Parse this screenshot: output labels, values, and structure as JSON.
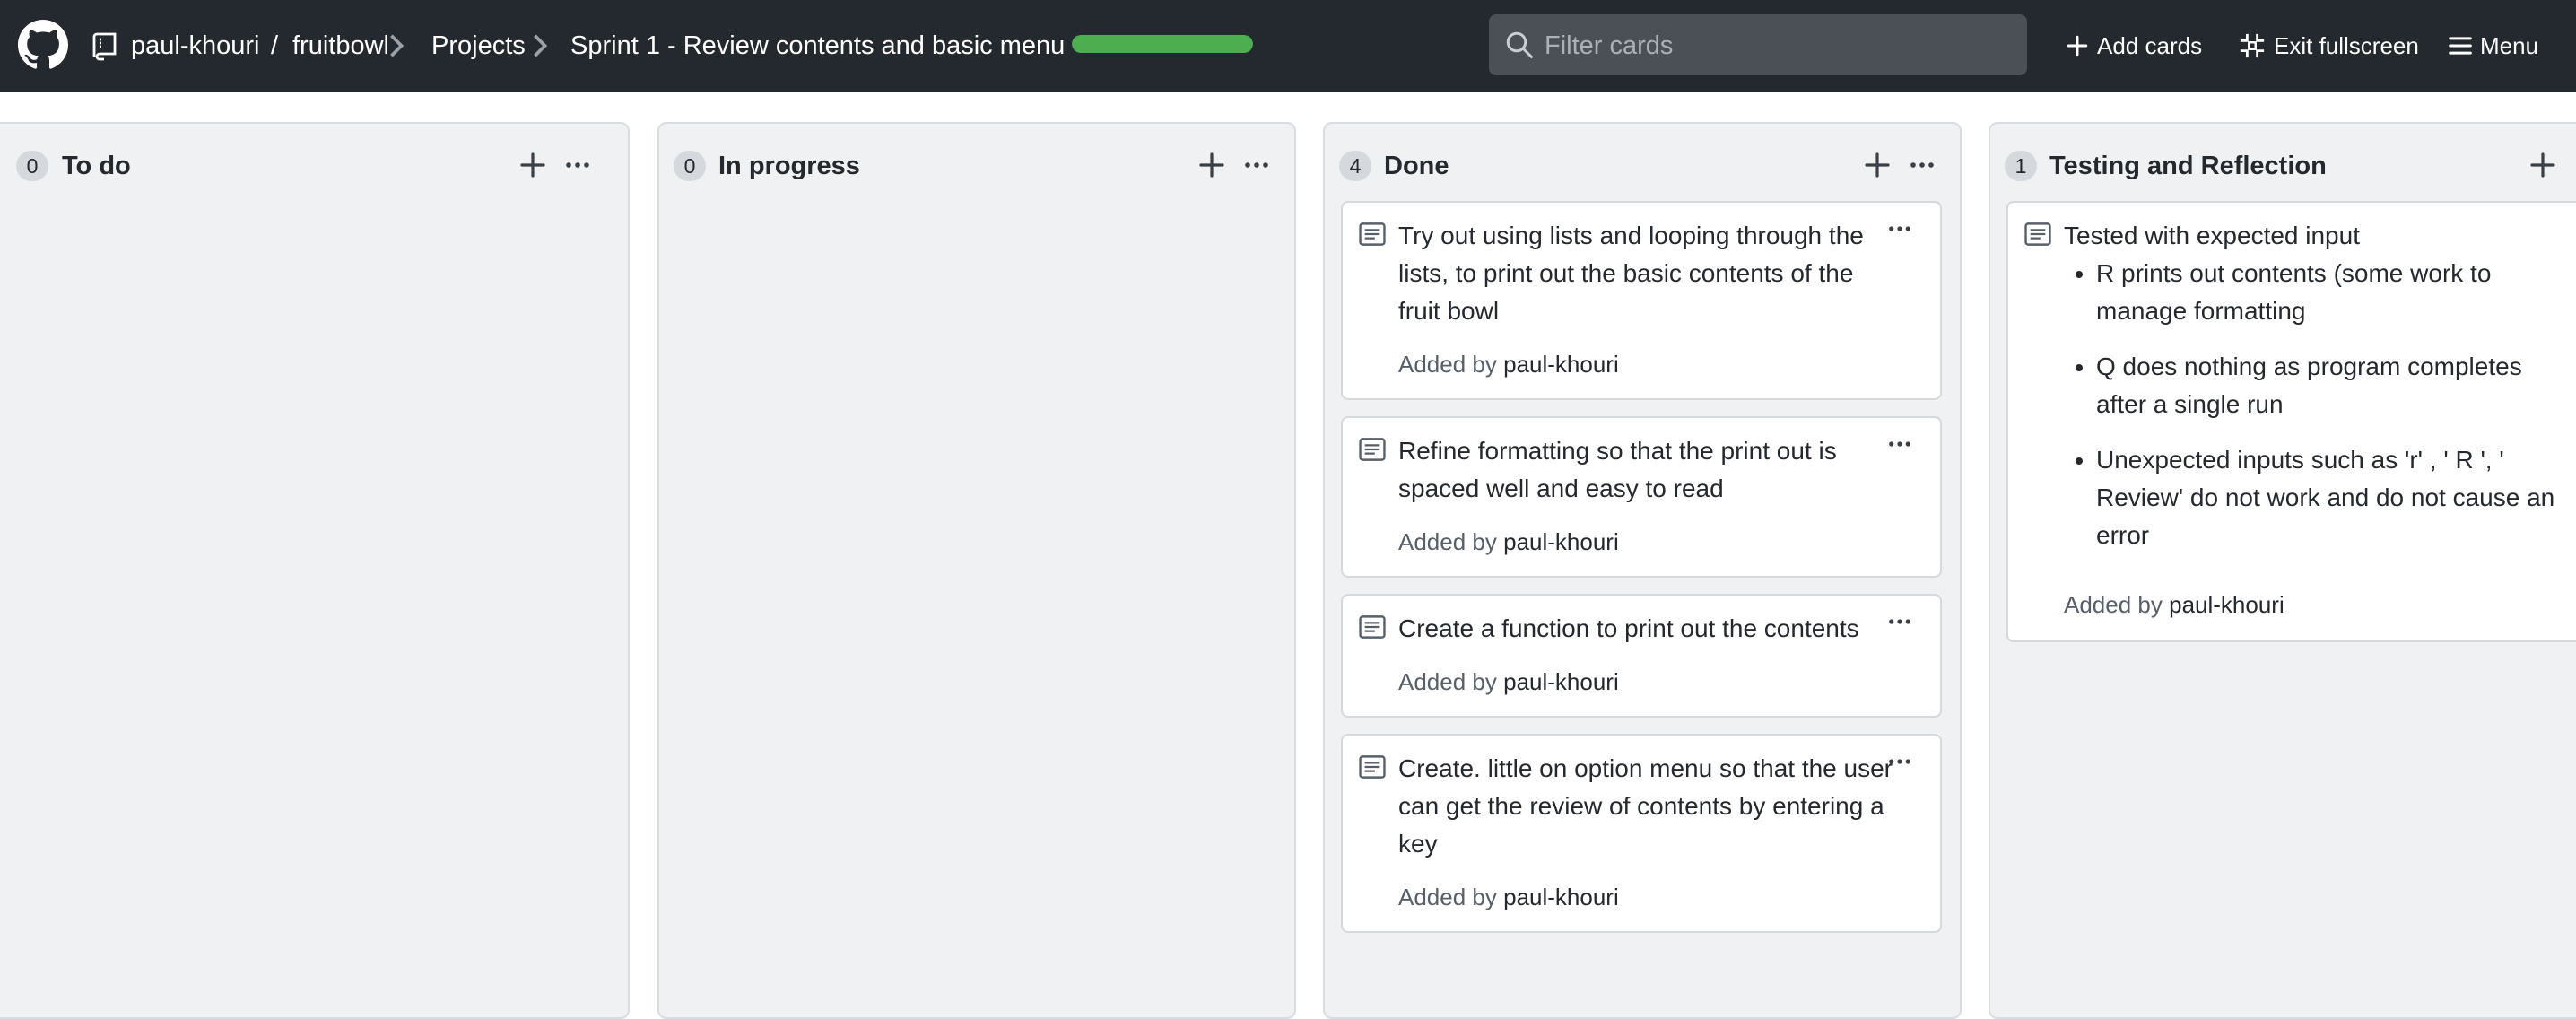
{
  "header": {
    "breadcrumb": {
      "owner": "paul-khouri",
      "separator": "/",
      "repo": "fruitbowl",
      "projects": "Projects",
      "project": "Sprint 1 - Review contents and basic menu"
    },
    "progress_fraction": 1.0,
    "progress_color": "#4cae4f",
    "filter_placeholder": "Filter cards",
    "add_cards": "Add cards",
    "exit_fullscreen": "Exit fullscreen",
    "menu": "Menu"
  },
  "columns": [
    {
      "count": "0",
      "title": "To do",
      "cards": []
    },
    {
      "count": "0",
      "title": "In progress",
      "cards": []
    },
    {
      "count": "4",
      "title": "Done",
      "cards": [
        {
          "text": "Try out using lists and looping through the lists, to print out the basic contents of the fruit bowl",
          "added_by_label": "Added by",
          "user": "paul-khouri"
        },
        {
          "text": "Refine formatting so that the print out is spaced well and easy to read",
          "added_by_label": "Added by",
          "user": "paul-khouri"
        },
        {
          "text": "Create a function to print out the contents",
          "added_by_label": "Added by",
          "user": "paul-khouri"
        },
        {
          "text": "Create. little on option menu so that the user can get the review of contents by entering a key",
          "added_by_label": "Added by",
          "user": "paul-khouri"
        }
      ]
    },
    {
      "count": "1",
      "title": "Testing and Reflection",
      "cards": [
        {
          "text": "Tested with expected input",
          "bullets": [
            "R prints out contents (some work to manage formatting",
            "Q does nothing as program completes after a single run",
            "Unexpected inputs such as 'r' , ' R ', ' Review' do not work and do not cause an error"
          ],
          "added_by_label": "Added by",
          "user": "paul-khouri"
        }
      ]
    }
  ]
}
